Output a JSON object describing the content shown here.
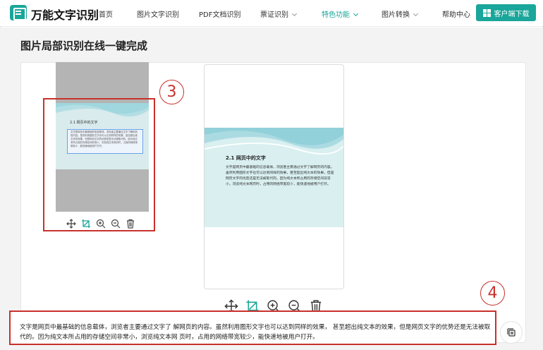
{
  "header": {
    "brand": "万能文字识别",
    "nav": [
      "首页",
      "图片文字识别",
      "PDF文档识别",
      "票证识别",
      "特色功能",
      "图片转换",
      "帮助中心"
    ],
    "download_label": "客户端下载"
  },
  "main": {
    "title": "图片局部识别在线一键完成",
    "callouts": [
      "3",
      "4"
    ],
    "thumbnail": {
      "heading": "2.1 网页中的文字",
      "text": "文字是网页中最基础的信息载体。浏览者主要通过文字了解网页的内容。虽然利用图形文字也可以达到同样的效果，甚至超出纯文本的效果，但是网页文字的优势还是无法被取代的。因为纯文本所占用的存储空间非常小，浏览纯文本网页时，占用的网络带宽较少，能快速地被用户打开。"
    },
    "preview": {
      "heading": "2.1 网页中的文字",
      "text": "文字是网页中最基础的信息载体。浏览者主要通过文字了解网页的内容。虽然利用图形文字也可以达到同样的效果，甚至超出纯文本的效果，但是网页文字的优势还是无法被取代的。因为纯文本所占用的存储空间非常小，浏览纯文本网页时，占用的网络带宽较少，能快速地被用户打开。"
    },
    "result_text": "文字是网页中最基础的信息载体，浏览者主要通过文字了 解网页的内容。虽然利用图形文字也可以达到同样的效果， 甚至超出纯文本的效果，但是网页文字的优势还是无法被取 代的。因为纯文本所占用的存储空间非常小，浏览纯文本网 页时，占用的网络带宽较少，能快速地被用户打开。"
  },
  "colors": {
    "accent": "#1aa69a",
    "callout": "#c9302c"
  },
  "icons": [
    "move-icon",
    "crop-icon",
    "zoom-in-icon",
    "zoom-out-icon",
    "delete-icon",
    "copy-icon",
    "windows-icon"
  ]
}
